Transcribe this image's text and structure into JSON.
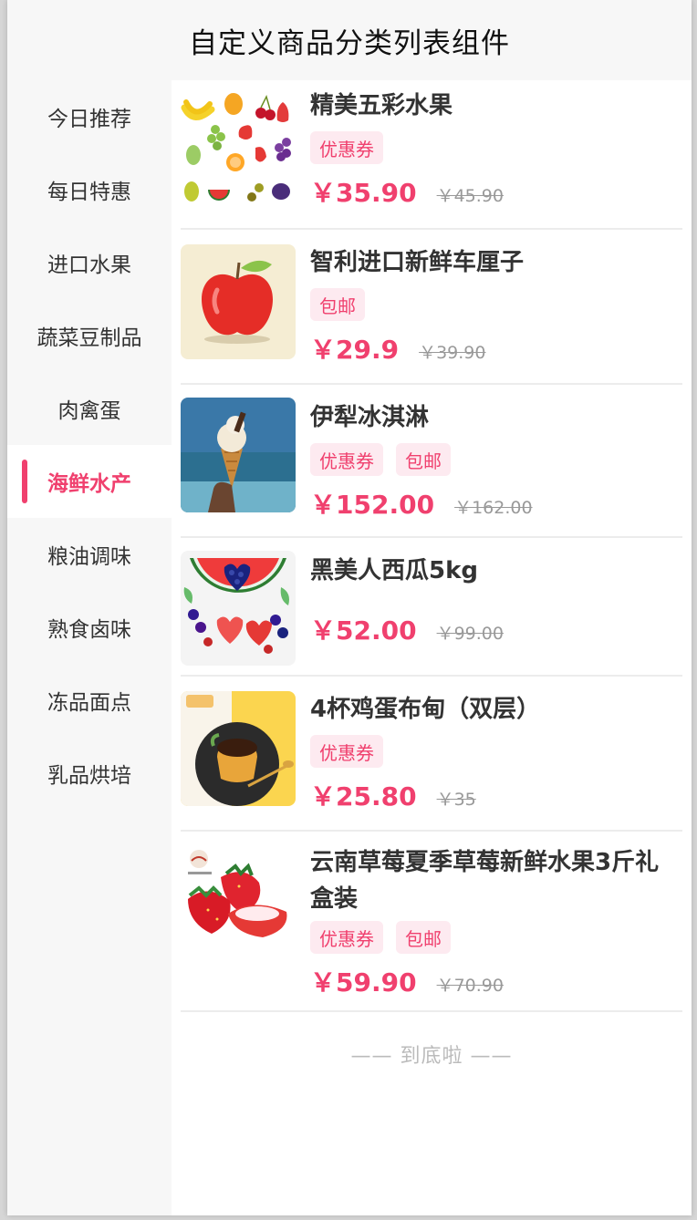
{
  "navbar": {
    "title": "自定义商品分类列表组件"
  },
  "sidebar": {
    "items": [
      {
        "label": "今日推荐"
      },
      {
        "label": "每日特惠"
      },
      {
        "label": "进口水果"
      },
      {
        "label": "蔬菜豆制品"
      },
      {
        "label": "肉禽蛋"
      },
      {
        "label": "海鲜水产",
        "active": true
      },
      {
        "label": "粮油调味"
      },
      {
        "label": "熟食卤味"
      },
      {
        "label": "冻品面点"
      },
      {
        "label": "乳品烘培"
      }
    ]
  },
  "products": [
    {
      "name": "精美五彩水果",
      "tags": [
        "优惠券"
      ],
      "price": "￥35.90",
      "original_price": "￥45.90",
      "image": "mixed-fruits-image"
    },
    {
      "name": "智利进口新鲜车厘子",
      "tags": [
        "包邮"
      ],
      "price": "￥29.9",
      "original_price": "￥39.90",
      "image": "red-apple-image"
    },
    {
      "name": "伊犁冰淇淋",
      "tags": [
        "优惠券",
        "包邮"
      ],
      "price": "￥152.00",
      "original_price": "￥162.00",
      "image": "ice-cream-cone-image"
    },
    {
      "name": "黑美人西瓜5kg",
      "tags": [],
      "price": "￥52.00",
      "original_price": "￥99.00",
      "image": "watermelon-berries-image"
    },
    {
      "name": "4杯鸡蛋布甸（双层）",
      "tags": [
        "优惠券"
      ],
      "price": "￥25.80",
      "original_price": "￥35",
      "image": "pudding-image"
    },
    {
      "name": "云南草莓夏季草莓新鲜水果3斤礼盒装",
      "tags": [
        "优惠券",
        "包邮"
      ],
      "price": "￥59.90",
      "original_price": "￥70.90",
      "image": "strawberries-image"
    }
  ],
  "footer": {
    "end_text": "—— 到底啦 ——"
  },
  "colors": {
    "accent": "#f0406e",
    "tag_bg": "#fdeaf0",
    "sidebar_bg": "#f7f7f7"
  }
}
